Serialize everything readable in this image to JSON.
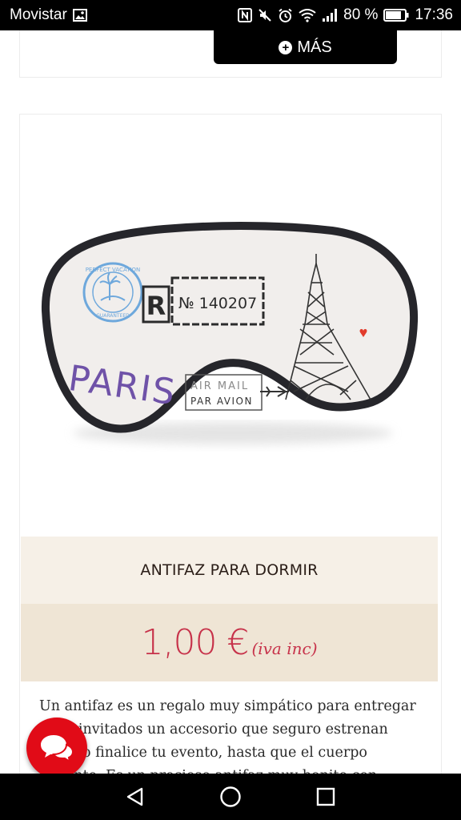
{
  "status_bar": {
    "carrier": "Movistar",
    "battery": "80 %",
    "time": "17:36"
  },
  "header": {
    "more_label": "MÁS"
  },
  "product": {
    "image": {
      "ticket_prefix": "R",
      "ticket_number": "№ 140207",
      "city_text": "PARIS",
      "airmail_line1": "AIR MAIL",
      "airmail_line2": "PAR AVION",
      "stamp_text_top": "PERFECT VACATION",
      "stamp_text_bottom": "GUARANTEED"
    },
    "title": "ANTIFAZ PARA DORMIR",
    "price": "1,00 €",
    "price_note": "(iva inc)",
    "description": "Un antifaz es un regalo muy simpático para entregar a tus invitados un accesorio que seguro estrenan cuando finalice tu evento, hasta que el cuerpo aguante. Es un precioso antifaz muy bonito con diseño vintage y motivos"
  },
  "colors": {
    "price": "#c7324a",
    "title_band": "#f6f0e7",
    "price_band": "#efe5d5",
    "chat_fab": "#e10b17"
  }
}
